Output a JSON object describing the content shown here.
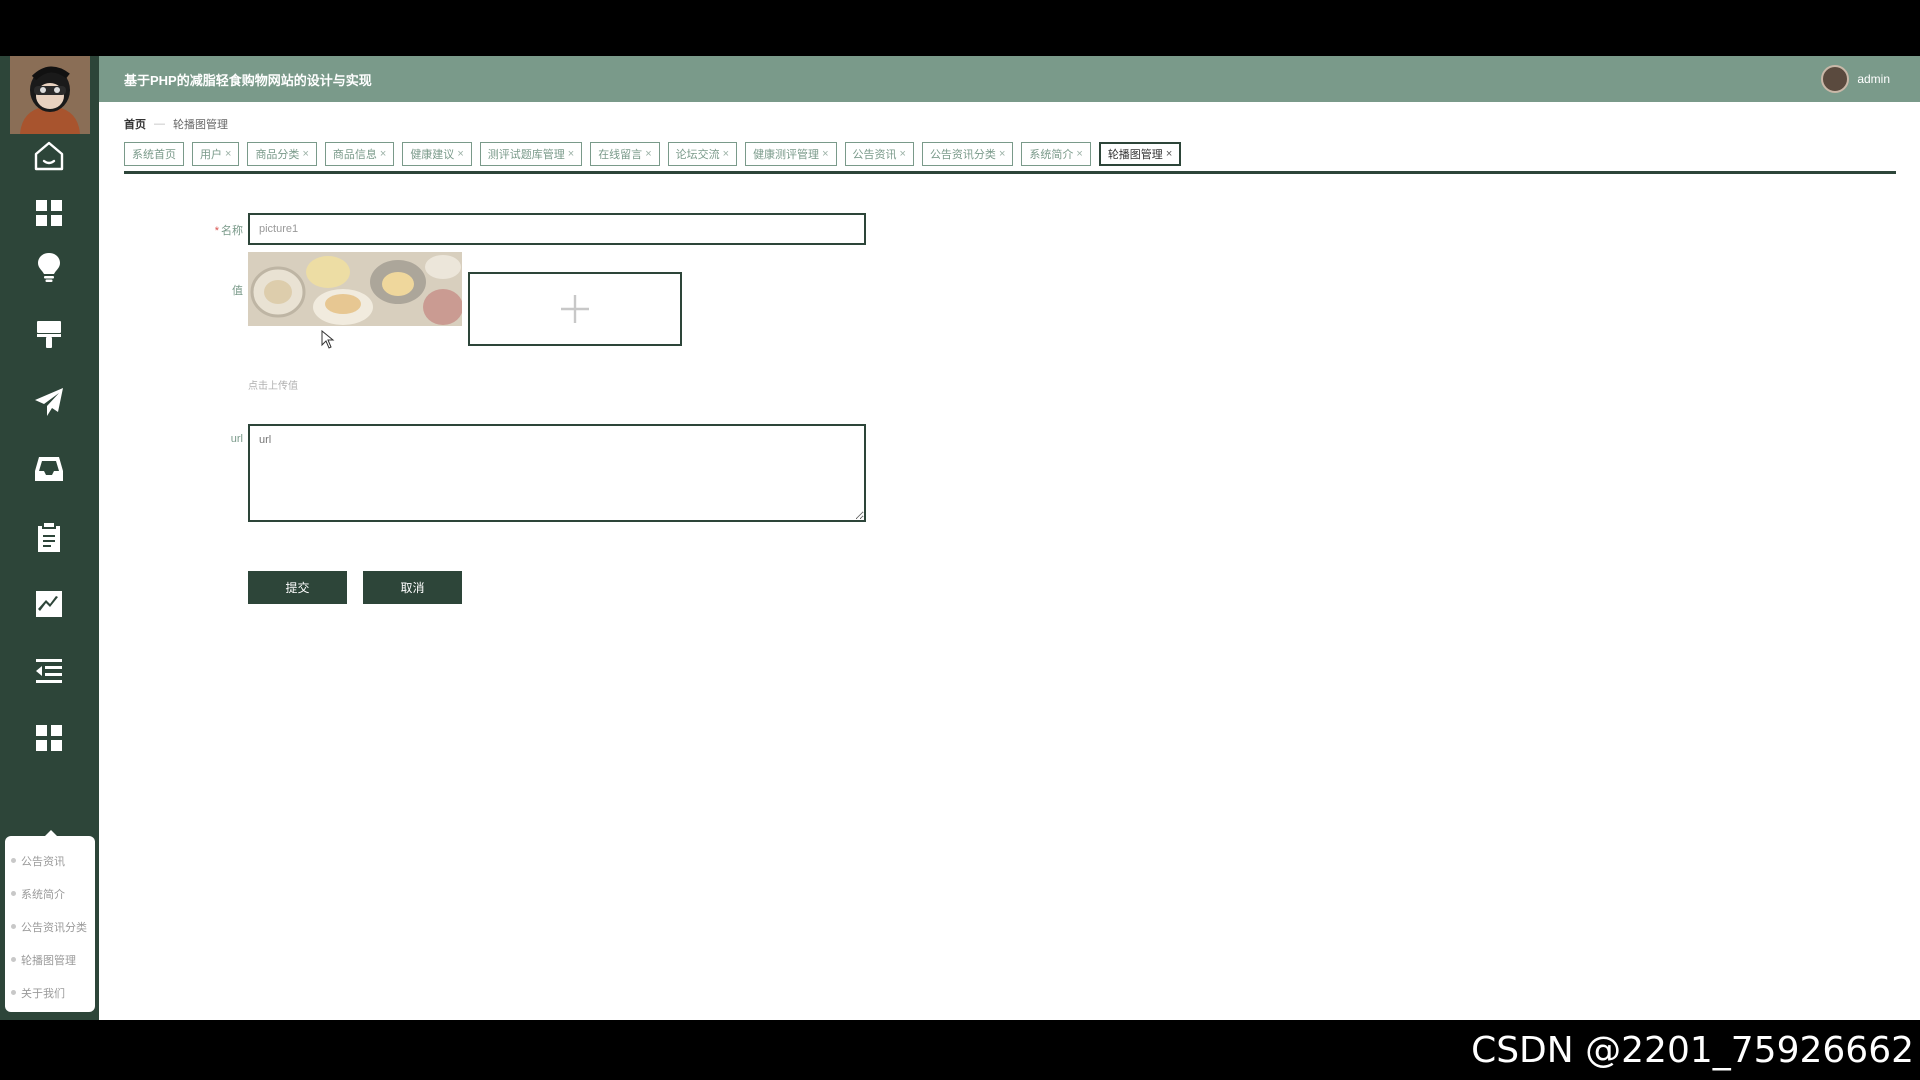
{
  "app": {
    "title": "基于PHP的减脂轻食购物网站的设计与实现",
    "user": "admin"
  },
  "breadcrumb": {
    "home": "首页",
    "separator": "—",
    "current": "轮播图管理"
  },
  "tabs": [
    {
      "label": "系统首页",
      "closable": false,
      "active": false
    },
    {
      "label": "用户",
      "closable": true,
      "active": false
    },
    {
      "label": "商品分类",
      "closable": true,
      "active": false
    },
    {
      "label": "商品信息",
      "closable": true,
      "active": false
    },
    {
      "label": "健康建议",
      "closable": true,
      "active": false
    },
    {
      "label": "测评试题库管理",
      "closable": true,
      "active": false
    },
    {
      "label": "在线留言",
      "closable": true,
      "active": false
    },
    {
      "label": "论坛交流",
      "closable": true,
      "active": false
    },
    {
      "label": "健康测评管理",
      "closable": true,
      "active": false
    },
    {
      "label": "公告资讯",
      "closable": true,
      "active": false
    },
    {
      "label": "公告资讯分类",
      "closable": true,
      "active": false
    },
    {
      "label": "系统简介",
      "closable": true,
      "active": false
    },
    {
      "label": "轮播图管理",
      "closable": true,
      "active": true
    }
  ],
  "tab_close_glyph": "×",
  "sidebar": {
    "icons": [
      "home-icon",
      "grid-icon",
      "lightbulb-icon",
      "paint-roller-icon",
      "paper-plane-icon",
      "inbox-icon",
      "clipboard-icon",
      "chart-line-icon",
      "menu-collapse-icon",
      "grid-icon"
    ],
    "submenu": [
      "公告资讯",
      "系统简介",
      "公告资讯分类",
      "轮播图管理",
      "关于我们"
    ]
  },
  "form": {
    "name_required_mark": "*",
    "name_label": "名称",
    "name_value": "picture1",
    "value_label": "值",
    "upload_hint": "点击上传值",
    "url_label": "url",
    "url_placeholder": "url",
    "submit_label": "提交",
    "cancel_label": "取消"
  },
  "watermark": "CSDN @2201_75926662",
  "colors": {
    "sidebar": "#2d4539",
    "header": "#7a9a8a",
    "accent": "#2d4539"
  }
}
